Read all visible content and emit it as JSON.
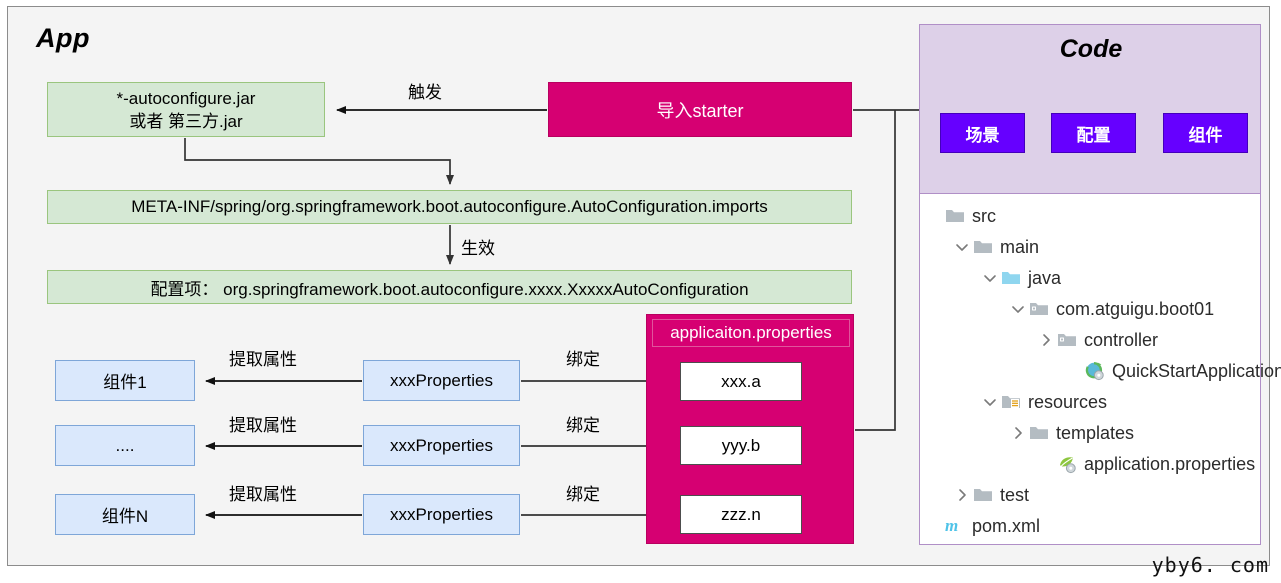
{
  "app": {
    "title": "App",
    "jar_box": {
      "line1": "*-autoconfigure.jar",
      "line2": "或者 第三方.jar"
    },
    "import_starter": "导入starter",
    "metainf": "META-INF/spring/org.springframework.boot.autoconfigure.AutoConfiguration.imports",
    "config_item": "配置项： org.springframework.boot.autoconfigure.xxxx.XxxxxAutoConfiguration",
    "labels": {
      "trigger": "触发",
      "effective": "生效",
      "extract_property_1": "提取属性",
      "extract_property_2": "提取属性",
      "extract_property_3": "提取属性",
      "bind_1": "绑定",
      "bind_2": "绑定",
      "bind_3": "绑定"
    },
    "components": [
      {
        "name": "组件1"
      },
      {
        "name": "...."
      },
      {
        "name": "组件N"
      }
    ],
    "properties_classes": [
      {
        "name": "xxxProperties"
      },
      {
        "name": "xxxProperties"
      },
      {
        "name": "xxxProperties"
      }
    ],
    "application_properties": {
      "title": "applicaiton.properties",
      "entries": [
        {
          "key": "xxx.a"
        },
        {
          "key": "yyy.b"
        },
        {
          "key": "zzz.n"
        }
      ]
    }
  },
  "code": {
    "title": "Code",
    "buttons": [
      {
        "label": "场景"
      },
      {
        "label": "配置"
      },
      {
        "label": "组件"
      }
    ]
  },
  "file_tree": [
    {
      "label": "src",
      "depth": 0,
      "chevron": "none",
      "icon": "folder-icon"
    },
    {
      "label": "main",
      "depth": 1,
      "chevron": "down",
      "icon": "folder-icon"
    },
    {
      "label": "java",
      "depth": 2,
      "chevron": "down",
      "icon": "folder-source-icon"
    },
    {
      "label": "com.atguigu.boot01",
      "depth": 3,
      "chevron": "down",
      "icon": "folder-package-icon"
    },
    {
      "label": "controller",
      "depth": 4,
      "chevron": "right",
      "icon": "folder-package-icon"
    },
    {
      "label": "QuickStartApplication",
      "depth": 5,
      "chevron": "none",
      "icon": "spring-boot-class-icon"
    },
    {
      "label": "resources",
      "depth": 2,
      "chevron": "down",
      "icon": "folder-resources-icon"
    },
    {
      "label": "templates",
      "depth": 3,
      "chevron": "right",
      "icon": "folder-icon"
    },
    {
      "label": "application.properties",
      "depth": 4,
      "chevron": "none",
      "icon": "spring-properties-icon"
    },
    {
      "label": "test",
      "depth": 1,
      "chevron": "right",
      "icon": "folder-icon"
    },
    {
      "label": "pom.xml",
      "depth": 0,
      "chevron": "none",
      "icon": "maven-icon"
    }
  ],
  "watermark": "yby6. com",
  "colors": {
    "green_fill": "#d5e8d4",
    "green_stroke": "#9ac57e",
    "blue_fill": "#dae8fc",
    "blue_stroke": "#7ea6d8",
    "pink_fill": "#d60072",
    "purple_fill": "#6600ff",
    "code_panel_fill": "#ddd0e8",
    "app_fill": "#f4f4f4",
    "line": "#333333"
  }
}
